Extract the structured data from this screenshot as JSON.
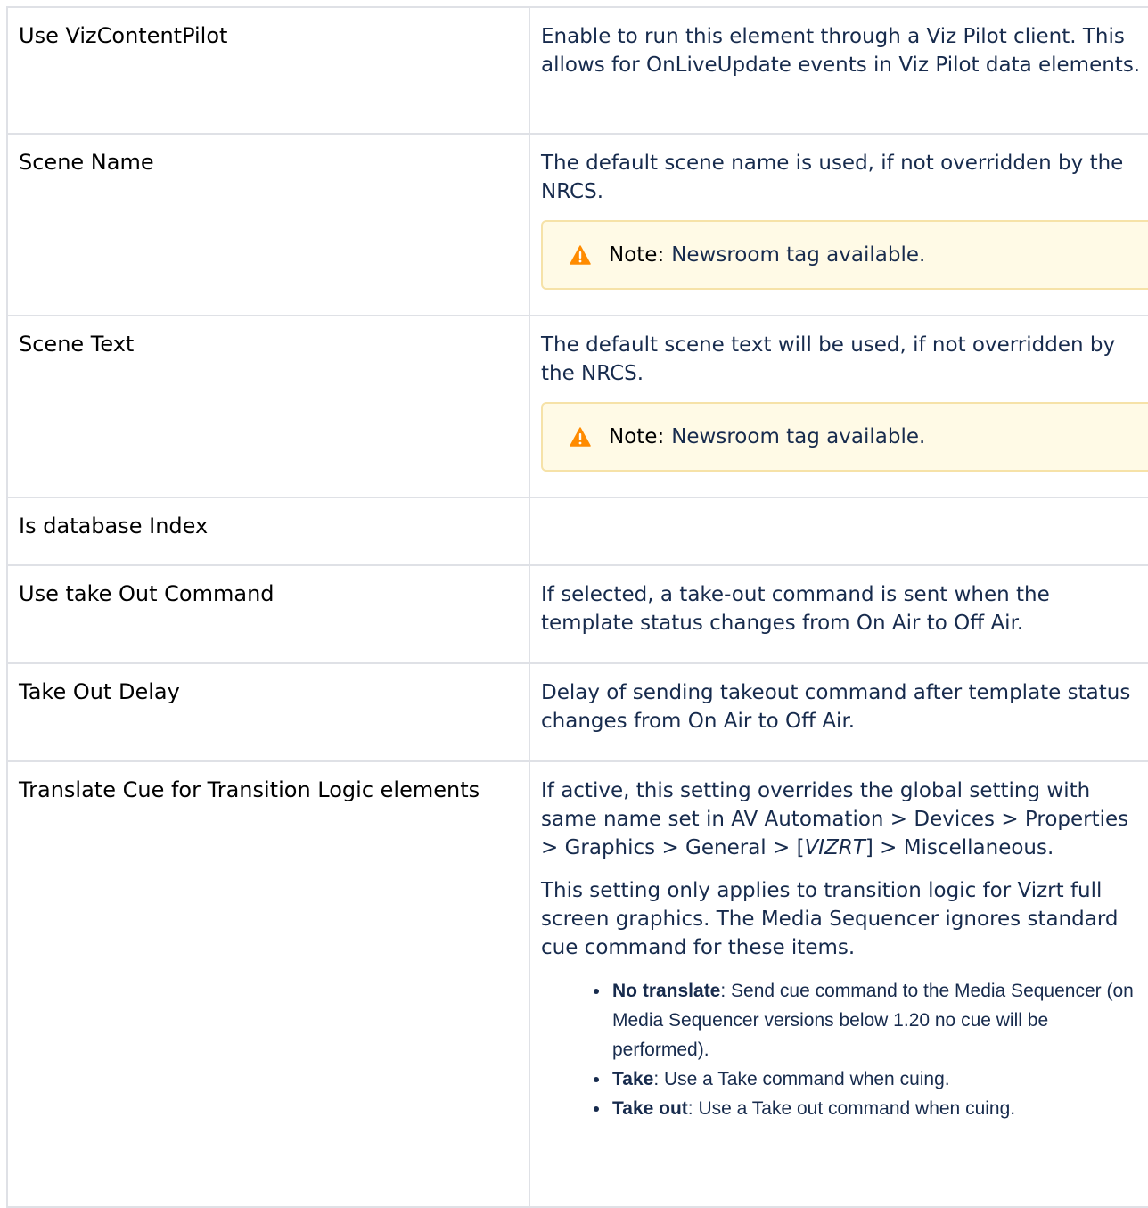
{
  "rows": [
    {
      "name": "Use VizContentPilot",
      "description": "Enable to run this element through a Viz Pilot client. This allows for OnLiveUpdate events in Viz Pilot data elements."
    },
    {
      "name": "Scene Name",
      "description": "The default scene name is used, if not overridden by the NRCS.",
      "note": {
        "label": "Note:",
        "text": "Newsroom tag available.",
        "icon": "warning-icon",
        "accent": "#ff8b00"
      }
    },
    {
      "name": "Scene Text",
      "description": "The default scene text will be used, if not overridden by the NRCS.",
      "note": {
        "label": "Note:",
        "text": "Newsroom tag available.",
        "icon": "warning-icon",
        "accent": "#ff8b00"
      }
    },
    {
      "name": "Is database Index",
      "description": ""
    },
    {
      "name": "Use take Out Command",
      "description": "If selected, a take-out command is sent when the template status changes from On Air to Off Air."
    },
    {
      "name": "Take Out Delay",
      "description": "Delay of sending takeout command after template status changes from On Air to Off Air."
    },
    {
      "name": "Translate Cue for Transition Logic elements",
      "description_prefix": "If active, this setting overrides the global setting with same name set in AV Automation > Devices > Properties > Graphics > General > [",
      "description_italic": "VIZRT",
      "description_suffix": "] > Miscellaneous.",
      "description_2": "This setting only applies to transition logic for Vizrt full screen graphics. The Media Sequencer ignores standard cue command for these items.",
      "options": [
        {
          "label": "No translate",
          "text": ": Send cue command to the Media Sequencer (on Media Sequencer versions below 1.20 no cue will be performed)."
        },
        {
          "label": "Take",
          "text": ": Use a Take command when cuing."
        },
        {
          "label": "Take out",
          "text": ": Use a Take out command when cuing."
        }
      ]
    }
  ]
}
